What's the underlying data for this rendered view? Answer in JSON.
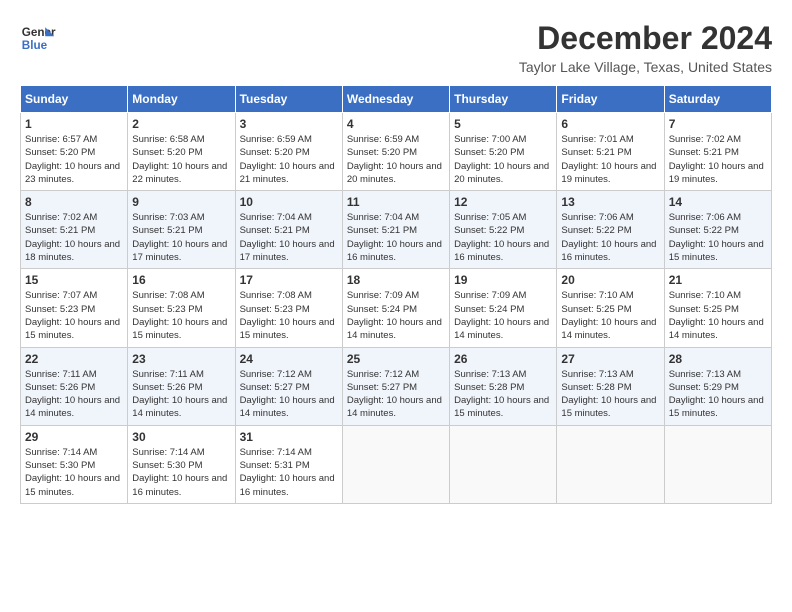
{
  "header": {
    "logo_line1": "General",
    "logo_line2": "Blue",
    "month": "December 2024",
    "location": "Taylor Lake Village, Texas, United States"
  },
  "weekdays": [
    "Sunday",
    "Monday",
    "Tuesday",
    "Wednesday",
    "Thursday",
    "Friday",
    "Saturday"
  ],
  "weeks": [
    [
      {
        "day": "1",
        "sunrise": "6:57 AM",
        "sunset": "5:20 PM",
        "daylight": "10 hours and 23 minutes."
      },
      {
        "day": "2",
        "sunrise": "6:58 AM",
        "sunset": "5:20 PM",
        "daylight": "10 hours and 22 minutes."
      },
      {
        "day": "3",
        "sunrise": "6:59 AM",
        "sunset": "5:20 PM",
        "daylight": "10 hours and 21 minutes."
      },
      {
        "day": "4",
        "sunrise": "6:59 AM",
        "sunset": "5:20 PM",
        "daylight": "10 hours and 20 minutes."
      },
      {
        "day": "5",
        "sunrise": "7:00 AM",
        "sunset": "5:20 PM",
        "daylight": "10 hours and 20 minutes."
      },
      {
        "day": "6",
        "sunrise": "7:01 AM",
        "sunset": "5:21 PM",
        "daylight": "10 hours and 19 minutes."
      },
      {
        "day": "7",
        "sunrise": "7:02 AM",
        "sunset": "5:21 PM",
        "daylight": "10 hours and 19 minutes."
      }
    ],
    [
      {
        "day": "8",
        "sunrise": "7:02 AM",
        "sunset": "5:21 PM",
        "daylight": "10 hours and 18 minutes."
      },
      {
        "day": "9",
        "sunrise": "7:03 AM",
        "sunset": "5:21 PM",
        "daylight": "10 hours and 17 minutes."
      },
      {
        "day": "10",
        "sunrise": "7:04 AM",
        "sunset": "5:21 PM",
        "daylight": "10 hours and 17 minutes."
      },
      {
        "day": "11",
        "sunrise": "7:04 AM",
        "sunset": "5:21 PM",
        "daylight": "10 hours and 16 minutes."
      },
      {
        "day": "12",
        "sunrise": "7:05 AM",
        "sunset": "5:22 PM",
        "daylight": "10 hours and 16 minutes."
      },
      {
        "day": "13",
        "sunrise": "7:06 AM",
        "sunset": "5:22 PM",
        "daylight": "10 hours and 16 minutes."
      },
      {
        "day": "14",
        "sunrise": "7:06 AM",
        "sunset": "5:22 PM",
        "daylight": "10 hours and 15 minutes."
      }
    ],
    [
      {
        "day": "15",
        "sunrise": "7:07 AM",
        "sunset": "5:23 PM",
        "daylight": "10 hours and 15 minutes."
      },
      {
        "day": "16",
        "sunrise": "7:08 AM",
        "sunset": "5:23 PM",
        "daylight": "10 hours and 15 minutes."
      },
      {
        "day": "17",
        "sunrise": "7:08 AM",
        "sunset": "5:23 PM",
        "daylight": "10 hours and 15 minutes."
      },
      {
        "day": "18",
        "sunrise": "7:09 AM",
        "sunset": "5:24 PM",
        "daylight": "10 hours and 14 minutes."
      },
      {
        "day": "19",
        "sunrise": "7:09 AM",
        "sunset": "5:24 PM",
        "daylight": "10 hours and 14 minutes."
      },
      {
        "day": "20",
        "sunrise": "7:10 AM",
        "sunset": "5:25 PM",
        "daylight": "10 hours and 14 minutes."
      },
      {
        "day": "21",
        "sunrise": "7:10 AM",
        "sunset": "5:25 PM",
        "daylight": "10 hours and 14 minutes."
      }
    ],
    [
      {
        "day": "22",
        "sunrise": "7:11 AM",
        "sunset": "5:26 PM",
        "daylight": "10 hours and 14 minutes."
      },
      {
        "day": "23",
        "sunrise": "7:11 AM",
        "sunset": "5:26 PM",
        "daylight": "10 hours and 14 minutes."
      },
      {
        "day": "24",
        "sunrise": "7:12 AM",
        "sunset": "5:27 PM",
        "daylight": "10 hours and 14 minutes."
      },
      {
        "day": "25",
        "sunrise": "7:12 AM",
        "sunset": "5:27 PM",
        "daylight": "10 hours and 14 minutes."
      },
      {
        "day": "26",
        "sunrise": "7:13 AM",
        "sunset": "5:28 PM",
        "daylight": "10 hours and 15 minutes."
      },
      {
        "day": "27",
        "sunrise": "7:13 AM",
        "sunset": "5:28 PM",
        "daylight": "10 hours and 15 minutes."
      },
      {
        "day": "28",
        "sunrise": "7:13 AM",
        "sunset": "5:29 PM",
        "daylight": "10 hours and 15 minutes."
      }
    ],
    [
      {
        "day": "29",
        "sunrise": "7:14 AM",
        "sunset": "5:30 PM",
        "daylight": "10 hours and 15 minutes."
      },
      {
        "day": "30",
        "sunrise": "7:14 AM",
        "sunset": "5:30 PM",
        "daylight": "10 hours and 16 minutes."
      },
      {
        "day": "31",
        "sunrise": "7:14 AM",
        "sunset": "5:31 PM",
        "daylight": "10 hours and 16 minutes."
      },
      null,
      null,
      null,
      null
    ]
  ],
  "labels": {
    "sunrise": "Sunrise:",
    "sunset": "Sunset:",
    "daylight": "Daylight: "
  }
}
